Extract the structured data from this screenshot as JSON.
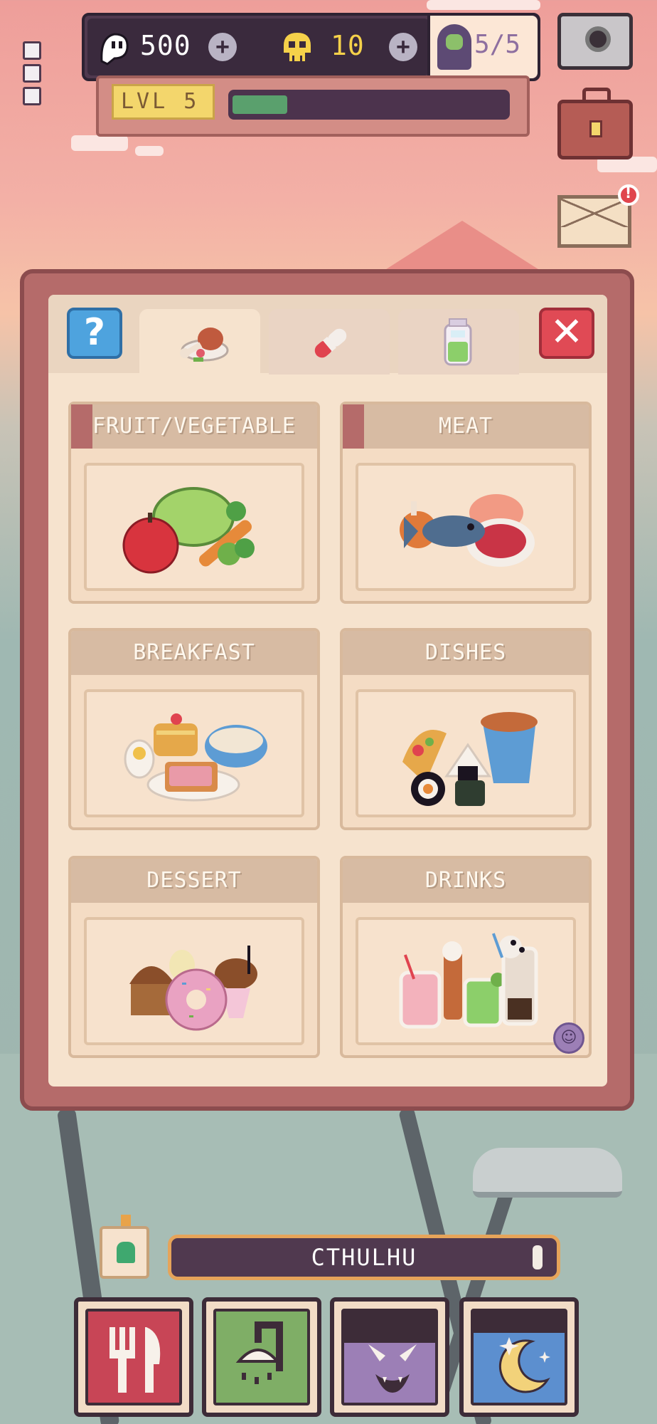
{
  "hud": {
    "soul_value": "500",
    "skull_value": "10",
    "energy_value": "5/5",
    "level_label": "LVL 5",
    "xp_progress": 0.2,
    "plus_symbol": "+"
  },
  "tabs": [
    {
      "name": "food-tab",
      "icon": "meat-icon",
      "active": true
    },
    {
      "name": "medicine-tab",
      "icon": "pill-icon",
      "active": false
    },
    {
      "name": "potion-tab",
      "icon": "potion-jar-icon",
      "active": false
    }
  ],
  "buttons": {
    "help_label": "?",
    "close_label": "✕"
  },
  "categories": [
    {
      "label": "FRUIT/VEGETABLE",
      "icon": "fruit-vegetable-icon"
    },
    {
      "label": "MEAT",
      "icon": "meat-fish-icon"
    },
    {
      "label": "BREAKFAST",
      "icon": "breakfast-icon"
    },
    {
      "label": "DISHES",
      "icon": "dishes-icon"
    },
    {
      "label": "DESSERT",
      "icon": "dessert-icon"
    },
    {
      "label": "DRINKS",
      "icon": "drinks-icon"
    }
  ],
  "pet": {
    "name": "CTHULHU"
  },
  "actions": [
    {
      "name": "feed-button",
      "icon": "fork-knife-icon",
      "glyph": "🍴",
      "color": "#c84556"
    },
    {
      "name": "bath-button",
      "icon": "shower-icon",
      "glyph": "🚿",
      "color": "#7fae66"
    },
    {
      "name": "play-button",
      "icon": "monster-face-icon",
      "glyph": "😈",
      "color": "#9c7fb6"
    },
    {
      "name": "sleep-button",
      "icon": "moon-stars-icon",
      "glyph": "☾",
      "color": "#5c8fcf"
    }
  ],
  "colors": {
    "panel_frame": "#b56b6a",
    "panel_bg": "#f6e3ce",
    "card_header": "#d7bba3",
    "hud_dark": "#50394f",
    "xp_green": "#5aa06d",
    "level_yellow": "#f3d66c"
  }
}
